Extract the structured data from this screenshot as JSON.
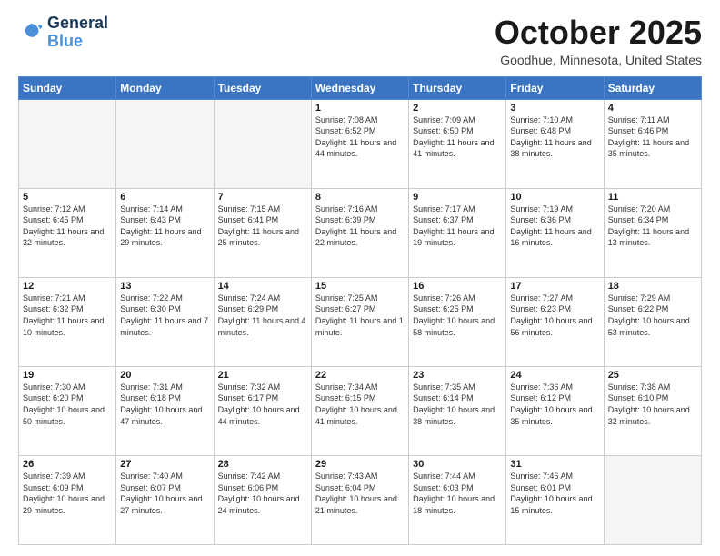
{
  "header": {
    "logo": {
      "line1": "General",
      "line2": "Blue"
    },
    "title": "October 2025",
    "location": "Goodhue, Minnesota, United States"
  },
  "days_of_week": [
    "Sunday",
    "Monday",
    "Tuesday",
    "Wednesday",
    "Thursday",
    "Friday",
    "Saturday"
  ],
  "weeks": [
    [
      {
        "day": "",
        "info": ""
      },
      {
        "day": "",
        "info": ""
      },
      {
        "day": "",
        "info": ""
      },
      {
        "day": "1",
        "info": "Sunrise: 7:08 AM\nSunset: 6:52 PM\nDaylight: 11 hours and 44 minutes."
      },
      {
        "day": "2",
        "info": "Sunrise: 7:09 AM\nSunset: 6:50 PM\nDaylight: 11 hours and 41 minutes."
      },
      {
        "day": "3",
        "info": "Sunrise: 7:10 AM\nSunset: 6:48 PM\nDaylight: 11 hours and 38 minutes."
      },
      {
        "day": "4",
        "info": "Sunrise: 7:11 AM\nSunset: 6:46 PM\nDaylight: 11 hours and 35 minutes."
      }
    ],
    [
      {
        "day": "5",
        "info": "Sunrise: 7:12 AM\nSunset: 6:45 PM\nDaylight: 11 hours and 32 minutes."
      },
      {
        "day": "6",
        "info": "Sunrise: 7:14 AM\nSunset: 6:43 PM\nDaylight: 11 hours and 29 minutes."
      },
      {
        "day": "7",
        "info": "Sunrise: 7:15 AM\nSunset: 6:41 PM\nDaylight: 11 hours and 25 minutes."
      },
      {
        "day": "8",
        "info": "Sunrise: 7:16 AM\nSunset: 6:39 PM\nDaylight: 11 hours and 22 minutes."
      },
      {
        "day": "9",
        "info": "Sunrise: 7:17 AM\nSunset: 6:37 PM\nDaylight: 11 hours and 19 minutes."
      },
      {
        "day": "10",
        "info": "Sunrise: 7:19 AM\nSunset: 6:36 PM\nDaylight: 11 hours and 16 minutes."
      },
      {
        "day": "11",
        "info": "Sunrise: 7:20 AM\nSunset: 6:34 PM\nDaylight: 11 hours and 13 minutes."
      }
    ],
    [
      {
        "day": "12",
        "info": "Sunrise: 7:21 AM\nSunset: 6:32 PM\nDaylight: 11 hours and 10 minutes."
      },
      {
        "day": "13",
        "info": "Sunrise: 7:22 AM\nSunset: 6:30 PM\nDaylight: 11 hours and 7 minutes."
      },
      {
        "day": "14",
        "info": "Sunrise: 7:24 AM\nSunset: 6:29 PM\nDaylight: 11 hours and 4 minutes."
      },
      {
        "day": "15",
        "info": "Sunrise: 7:25 AM\nSunset: 6:27 PM\nDaylight: 11 hours and 1 minute."
      },
      {
        "day": "16",
        "info": "Sunrise: 7:26 AM\nSunset: 6:25 PM\nDaylight: 10 hours and 58 minutes."
      },
      {
        "day": "17",
        "info": "Sunrise: 7:27 AM\nSunset: 6:23 PM\nDaylight: 10 hours and 56 minutes."
      },
      {
        "day": "18",
        "info": "Sunrise: 7:29 AM\nSunset: 6:22 PM\nDaylight: 10 hours and 53 minutes."
      }
    ],
    [
      {
        "day": "19",
        "info": "Sunrise: 7:30 AM\nSunset: 6:20 PM\nDaylight: 10 hours and 50 minutes."
      },
      {
        "day": "20",
        "info": "Sunrise: 7:31 AM\nSunset: 6:18 PM\nDaylight: 10 hours and 47 minutes."
      },
      {
        "day": "21",
        "info": "Sunrise: 7:32 AM\nSunset: 6:17 PM\nDaylight: 10 hours and 44 minutes."
      },
      {
        "day": "22",
        "info": "Sunrise: 7:34 AM\nSunset: 6:15 PM\nDaylight: 10 hours and 41 minutes."
      },
      {
        "day": "23",
        "info": "Sunrise: 7:35 AM\nSunset: 6:14 PM\nDaylight: 10 hours and 38 minutes."
      },
      {
        "day": "24",
        "info": "Sunrise: 7:36 AM\nSunset: 6:12 PM\nDaylight: 10 hours and 35 minutes."
      },
      {
        "day": "25",
        "info": "Sunrise: 7:38 AM\nSunset: 6:10 PM\nDaylight: 10 hours and 32 minutes."
      }
    ],
    [
      {
        "day": "26",
        "info": "Sunrise: 7:39 AM\nSunset: 6:09 PM\nDaylight: 10 hours and 29 minutes."
      },
      {
        "day": "27",
        "info": "Sunrise: 7:40 AM\nSunset: 6:07 PM\nDaylight: 10 hours and 27 minutes."
      },
      {
        "day": "28",
        "info": "Sunrise: 7:42 AM\nSunset: 6:06 PM\nDaylight: 10 hours and 24 minutes."
      },
      {
        "day": "29",
        "info": "Sunrise: 7:43 AM\nSunset: 6:04 PM\nDaylight: 10 hours and 21 minutes."
      },
      {
        "day": "30",
        "info": "Sunrise: 7:44 AM\nSunset: 6:03 PM\nDaylight: 10 hours and 18 minutes."
      },
      {
        "day": "31",
        "info": "Sunrise: 7:46 AM\nSunset: 6:01 PM\nDaylight: 10 hours and 15 minutes."
      },
      {
        "day": "",
        "info": ""
      }
    ]
  ]
}
